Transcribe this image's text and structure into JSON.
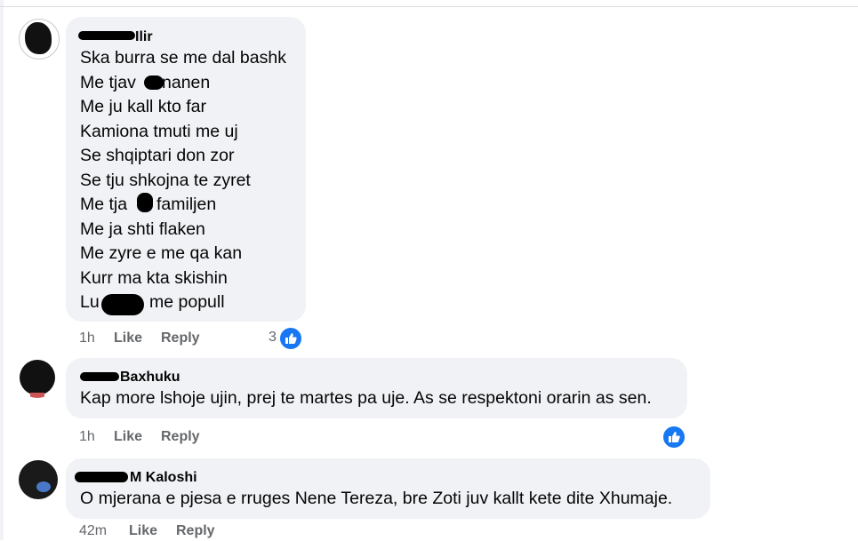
{
  "comments": [
    {
      "author_suffix": "Ilir",
      "lines": [
        "Ska burra se me dal bashk",
        "Me tjav",
        "nanen",
        "Me ju kall kto far",
        "Kamiona tmuti me uj",
        "Se shqiptari don zor",
        "Se tju shkojna te zyret",
        "Me tja",
        "familjen",
        "Me ja shti flaken",
        "Me zyre e me qa kan",
        "Kurr ma kta skishin",
        "Lu",
        "me popull"
      ],
      "time": "1h",
      "like": "Like",
      "reply": "Reply",
      "reaction_count": "3"
    },
    {
      "author_suffix": "Baxhuku",
      "text": "Kap more lshoje ujin, prej te martes pa uje. As se respektoni orarin as sen.",
      "time": "1h",
      "like": "Like",
      "reply": "Reply"
    },
    {
      "author_suffix": "M Kaloshi",
      "text": "O mjerana e pjesa e rruges Nene Tereza, bre Zoti juv kallt kete dite Xhumaje.",
      "time": "42m",
      "like": "Like",
      "reply": "Reply"
    }
  ],
  "colors": {
    "bubble": "#f0f2f5",
    "meta": "#65676b",
    "like_blue": "#1877f2"
  },
  "icons": {
    "reaction": "thumbs-up-icon"
  }
}
